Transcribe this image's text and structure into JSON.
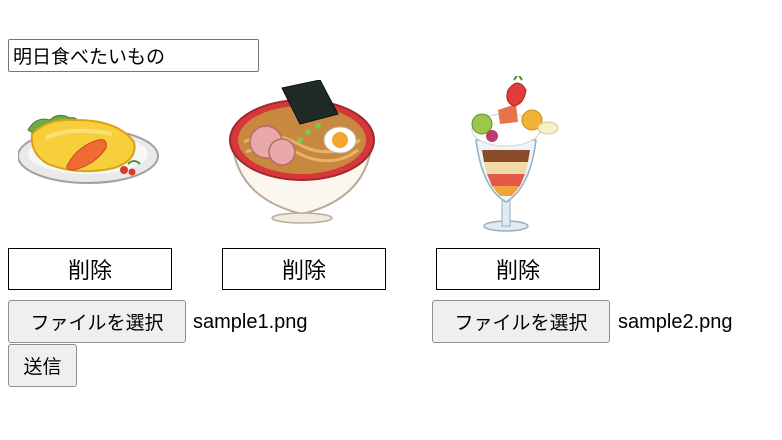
{
  "form": {
    "title_value": "明日食べたいもの",
    "submit_label": "送信"
  },
  "items": [
    {
      "image": "omurice-illustration",
      "delete_label": "削除",
      "file_button_label": "ファイルを選択",
      "file_name": "sample1.png"
    },
    {
      "image": "ramen-illustration",
      "delete_label": "削除"
    },
    {
      "image": "fruit-parfait-illustration",
      "delete_label": "削除",
      "file_button_label": "ファイルを選択",
      "file_name": "sample2.png"
    }
  ]
}
